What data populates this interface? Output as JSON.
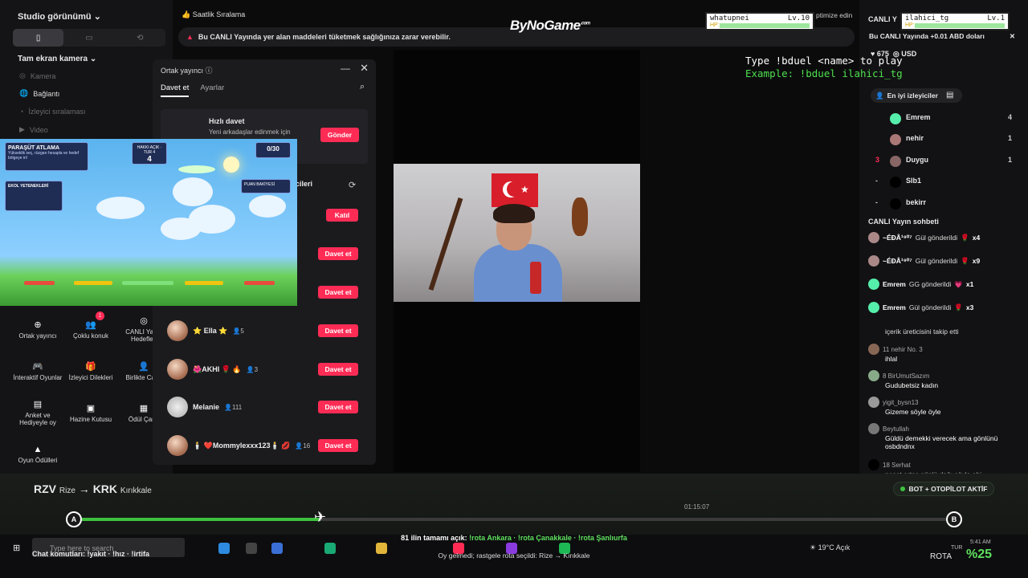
{
  "left": {
    "studio_title": "Studio görünümü ⌄",
    "fullscreen_camera": "Tam ekran kamera ⌄",
    "sources": [
      {
        "label": "Kamera",
        "on": false
      },
      {
        "label": "Bağlantı",
        "on": true
      },
      {
        "label": "İzleyici sıralaması",
        "on": false
      },
      {
        "label": "Video",
        "on": false
      }
    ],
    "tools": [
      {
        "label": "Ortak yayıncı",
        "icon": "⊕",
        "badge": ""
      },
      {
        "label": "Çoklu konuk",
        "icon": "👥",
        "badge": "1"
      },
      {
        "label": "CANLI Yayın Hedefleri",
        "icon": "◎",
        "badge": ""
      },
      {
        "label": "İnteraktif Oyunlar",
        "icon": "🎮",
        "badge": ""
      },
      {
        "label": "İzleyici Dilekleri",
        "icon": "🎁",
        "badge": ""
      },
      {
        "label": "Birlikte Canlı",
        "icon": "👤",
        "badge": ""
      },
      {
        "label": "Anket ve Hediyeyle oy",
        "icon": "▤",
        "badge": ""
      },
      {
        "label": "Hazine Kutusu",
        "icon": "▣",
        "badge": ""
      },
      {
        "label": "Ödül Çarkı",
        "icon": "▦",
        "badge": ""
      },
      {
        "label": "Oyun Ödülleri",
        "icon": "▲",
        "badge": ""
      }
    ]
  },
  "top": {
    "hourly_rank": "Saatlik Sıralama",
    "notice": "Bu CANLI Yayında yer alan maddeleri tüketmek sağlığınıza zarar verebilir.",
    "logo": "ByNoGame",
    "logo_sup": ".com",
    "optimize": "ptimize edin"
  },
  "cohost": {
    "title": "Ortak yayıncı",
    "tabs": [
      "Davet et",
      "Ayarlar"
    ],
    "quick_title": "Hızlı davet",
    "quick_desc": "Yeni arkadaşlar edinmek için",
    "send": "Gönder",
    "section_suffix": "cileri",
    "join": "Katıl",
    "invite": "Davet et",
    "users": [
      {
        "name": "",
        "viewers": ""
      },
      {
        "name": "",
        "viewers": ""
      },
      {
        "name": "⭐ Ella ⭐",
        "viewers": "5"
      },
      {
        "name": "🌺AKHI 🌹 🔥",
        "viewers": "3"
      },
      {
        "name": "Melanie",
        "viewers": "111"
      },
      {
        "name": "🕯️ ❤️Mommylexxx123🕯️ 💋",
        "viewers": "16"
      }
    ]
  },
  "game": {
    "title": "PARAŞÜT ATLAMA",
    "subtitle": "Yükseklik seç, rüzgarı hesapla ve hedef bölgeye in!",
    "counter": "0/30",
    "round_label": "HAKKI AÇIK · TUR 4",
    "round_value": "4",
    "score_label": "PUAN BAKİYESİ",
    "left_panel_title": "EKOL YETENEKLERİ"
  },
  "right": {
    "hp1_name": "whatupnei",
    "hp1_lv": "Lv.10",
    "hp2_name": "ilahici_tg",
    "hp2_lv": "Lv.1",
    "hp_label": "HP:",
    "live_prefix": "CANLI Y",
    "ticker": "Bu CANLI Yayında +0.01 ABD doları",
    "likes": "675",
    "currency": "USD",
    "top_viewers": "En iyi izleyiciler",
    "viewers": [
      {
        "rank": "",
        "name": "Emrem",
        "score": "4"
      },
      {
        "rank": "",
        "name": "nehir",
        "score": "1"
      },
      {
        "rank": "3",
        "name": "Duygu",
        "score": "1"
      },
      {
        "rank": "-",
        "name": "Slb1",
        "score": ""
      },
      {
        "rank": "-",
        "name": "bekirr",
        "score": ""
      }
    ],
    "chat_title": "CANLI Yayın sohbeti",
    "gifts": [
      {
        "user": "~ÉÐÂ¹⁹⁰⁷",
        "text": "Gül gönderildi",
        "count": "x4"
      },
      {
        "user": "~ÉÐÂ¹⁹⁰⁷",
        "text": "Gül gönderildi",
        "count": "x9"
      },
      {
        "user": "Emrem",
        "text": "GG gönderildi",
        "count": "x1"
      },
      {
        "user": "Emrem",
        "text": "Gül gönderildi",
        "count": "x3"
      }
    ],
    "messages": [
      {
        "user": "",
        "text": "içerik üreticisini takip etti"
      },
      {
        "user": "11 nehir No. 3",
        "text": "ihlal"
      },
      {
        "user": "8 BirUmutSazım",
        "text": "Gudubetsiz kadın"
      },
      {
        "user": "yigit_bysn13",
        "text": "Gizeme söyle öyle"
      },
      {
        "user": "Beytullah",
        "text": "Güldü demekki verecek ama gönlünü osbdndnx"
      },
      {
        "user": "18 Serhat",
        "text": "neşet ertaş gönlü dağı söyle abi"
      }
    ]
  },
  "overlay": {
    "line1": "Type !bduel <name> to play",
    "line2": "Example: !bduel ilahici_tg"
  },
  "route": {
    "from_code": "RZV",
    "from_name": "Rize",
    "arrow": "→",
    "to_code": "KRK",
    "to_name": "Kırıkkale",
    "start": "A",
    "end": "B",
    "progress": 0.28,
    "time": "01:15:07",
    "bot": "BOT + OTOPİLOT AKTİF"
  },
  "bottom": {
    "info1_prefix": "81 ilin tamamı açık:",
    "info1_cmds": "!rota Ankara · !rota Çanakkale · !rota Şanlıurfa",
    "info2": "Oy gelmedi; rastgele rota seçildi: Rize → Kırıkkale",
    "chat_commands": "Chat komutları: !yakıt · !hız · !irtifa",
    "search": "Type here to search",
    "weather": "19°C  Açık",
    "rota": "ROTA",
    "rota_pct": "%25",
    "clock": "5:41 AM",
    "lang": "TUR"
  }
}
